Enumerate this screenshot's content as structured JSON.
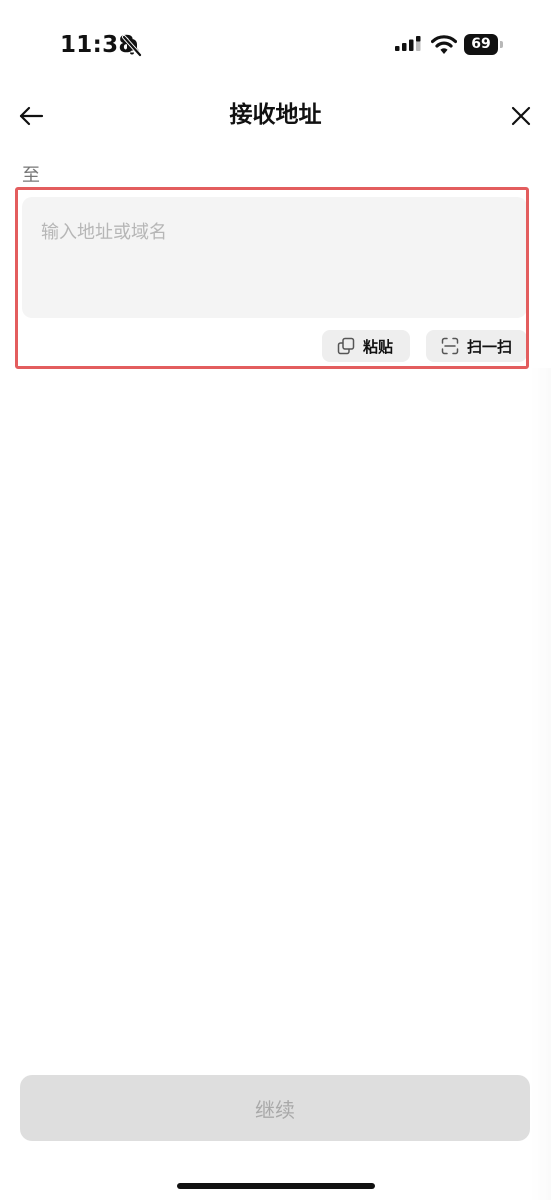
{
  "status_bar": {
    "time": "11:38",
    "battery_percent": "69",
    "battery_level": 0.69,
    "icons": [
      "bell-slash-icon",
      "cellular-signal-icon",
      "wifi-icon",
      "battery-icon"
    ]
  },
  "nav": {
    "back_icon": "arrow-left-icon",
    "title": "接收地址",
    "close_icon": "close-icon"
  },
  "form": {
    "label": "至",
    "address": {
      "value": "",
      "placeholder": "输入地址或域名"
    },
    "actions": {
      "paste": {
        "label": "粘贴",
        "icon": "copy-icon"
      },
      "scan": {
        "label": "扫一扫",
        "icon": "scan-icon"
      }
    }
  },
  "footer": {
    "continue_label": "继续",
    "continue_enabled": false
  },
  "colors": {
    "highlight": "#e35d5e",
    "input_background": "#f4f4f4",
    "chip_background": "#eeeeee",
    "disabled_button": "#dedede",
    "disabled_text": "#a9a9a9"
  }
}
